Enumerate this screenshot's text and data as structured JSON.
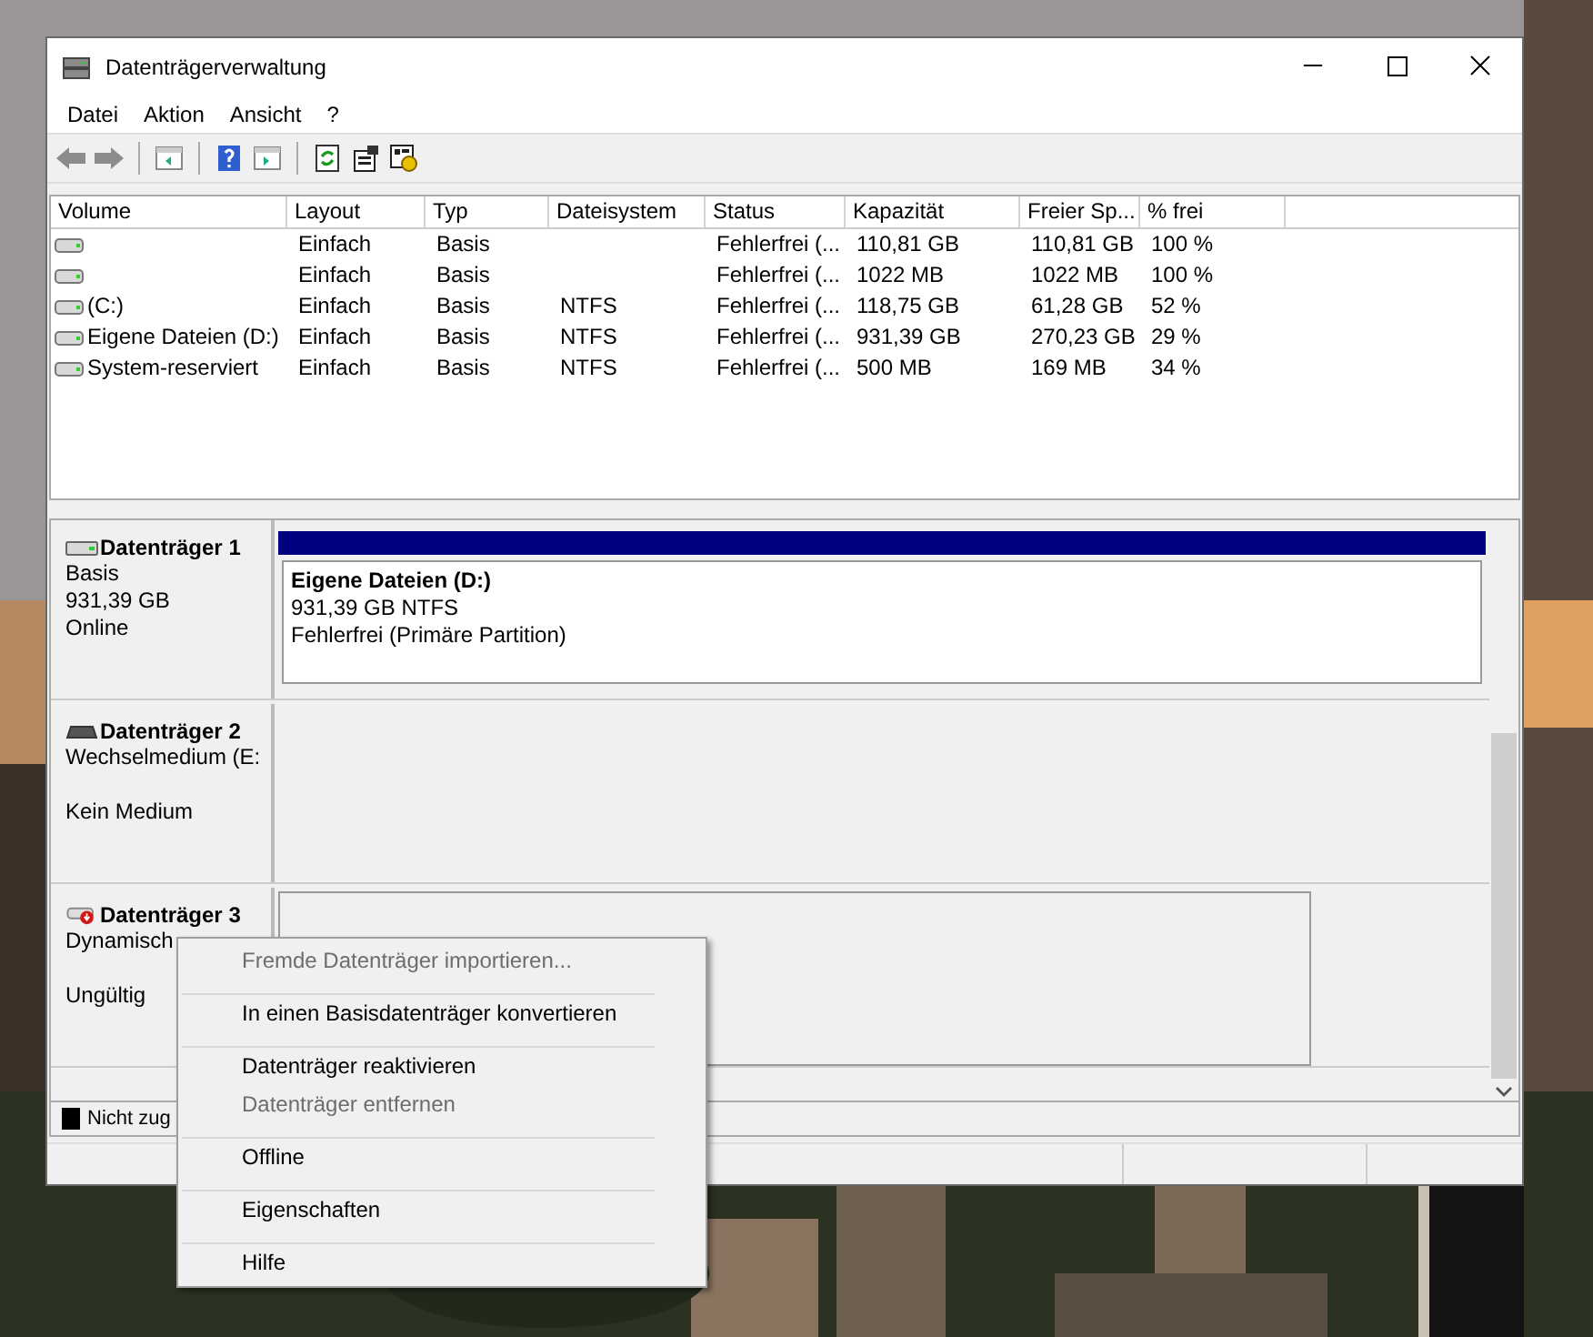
{
  "window": {
    "title": "Datenträgerverwaltung"
  },
  "menu": [
    "Datei",
    "Aktion",
    "Ansicht",
    "?"
  ],
  "table": {
    "columns": [
      "Volume",
      "Layout",
      "Typ",
      "Dateisystem",
      "Status",
      "Kapazität",
      "Freier Sp...",
      "% frei"
    ],
    "rows": [
      [
        "",
        "Einfach",
        "Basis",
        "",
        "Fehlerfrei (...",
        "110,81 GB",
        "110,81 GB",
        "100 %"
      ],
      [
        "",
        "Einfach",
        "Basis",
        "",
        "Fehlerfrei (...",
        "1022 MB",
        "1022 MB",
        "100 %"
      ],
      [
        "(C:)",
        "Einfach",
        "Basis",
        "NTFS",
        "Fehlerfrei (...",
        "118,75 GB",
        "61,28 GB",
        "52 %"
      ],
      [
        "Eigene Dateien (D:)",
        "Einfach",
        "Basis",
        "NTFS",
        "Fehlerfrei (...",
        "931,39 GB",
        "270,23 GB",
        "29 %"
      ],
      [
        "System-reserviert",
        "Einfach",
        "Basis",
        "NTFS",
        "Fehlerfrei (...",
        "500 MB",
        "169 MB",
        "34 %"
      ]
    ]
  },
  "disks": [
    {
      "kind": "basic",
      "name": "Datenträger 1",
      "type": "Basis",
      "size": "931,39 GB",
      "status": "Online",
      "partitions": [
        {
          "name": "Eigene Dateien  (D:)",
          "size": "931,39 GB NTFS",
          "status": "Fehlerfrei (Primäre Partition)"
        }
      ]
    },
    {
      "kind": "removable",
      "name": "Datenträger 2",
      "type": "Wechselmedium (E:",
      "status": "Kein Medium"
    },
    {
      "kind": "invalid",
      "name": "Datenträger 3",
      "type": "Dynamisch",
      "status": "Ungültig",
      "empty_box": true
    }
  ],
  "legend": [
    {
      "label": "Nicht zug",
      "color": "#000000"
    }
  ],
  "context_menu": {
    "items": [
      {
        "label": "Fremde Datenträger importieren...",
        "disabled": true,
        "separator_above": false
      },
      {
        "label": "In einen Basisdatenträger konvertieren",
        "disabled": false,
        "separator_above": true
      },
      {
        "label": "Datenträger reaktivieren",
        "disabled": false,
        "separator_above": true
      },
      {
        "label": "Datenträger entfernen",
        "disabled": true,
        "separator_above": false
      },
      {
        "label": "Offline",
        "disabled": false,
        "separator_above": true
      },
      {
        "label": "Eigenschaften",
        "disabled": false,
        "separator_above": true
      },
      {
        "label": "Hilfe",
        "disabled": false,
        "separator_above": true
      }
    ]
  }
}
